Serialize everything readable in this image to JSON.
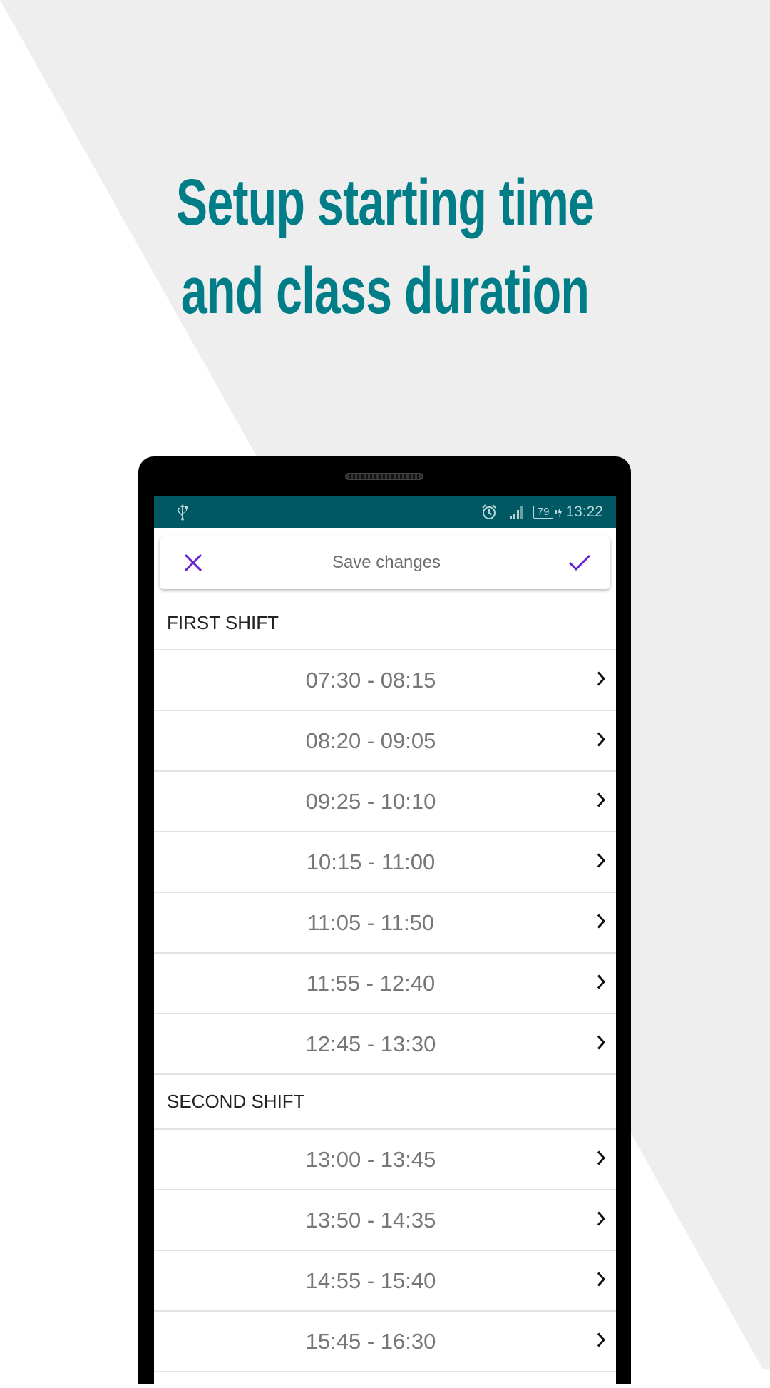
{
  "headline": {
    "line1": "Setup starting time",
    "line2": "and class duration"
  },
  "colors": {
    "headline": "#007d87",
    "status_bar": "#005862",
    "accent": "#6a1fd6"
  },
  "status_bar": {
    "left_icon": "usb-icon",
    "icons": [
      "alarm-icon",
      "signal-icon",
      "battery-icon",
      "charging-icon"
    ],
    "battery_level": "79",
    "time": "13:22"
  },
  "action_bar": {
    "cancel_icon": "close-icon",
    "title": "Save changes",
    "confirm_icon": "check-icon"
  },
  "sections": [
    {
      "title": "FIRST SHIFT",
      "periods": [
        "07:30 - 08:15",
        "08:20 - 09:05",
        "09:25 - 10:10",
        "10:15 - 11:00",
        "11:05 - 11:50",
        "11:55 - 12:40",
        "12:45 - 13:30"
      ]
    },
    {
      "title": "SECOND SHIFT",
      "periods": [
        "13:00 - 13:45",
        "13:50 - 14:35",
        "14:55 - 15:40",
        "15:45 - 16:30"
      ]
    }
  ]
}
